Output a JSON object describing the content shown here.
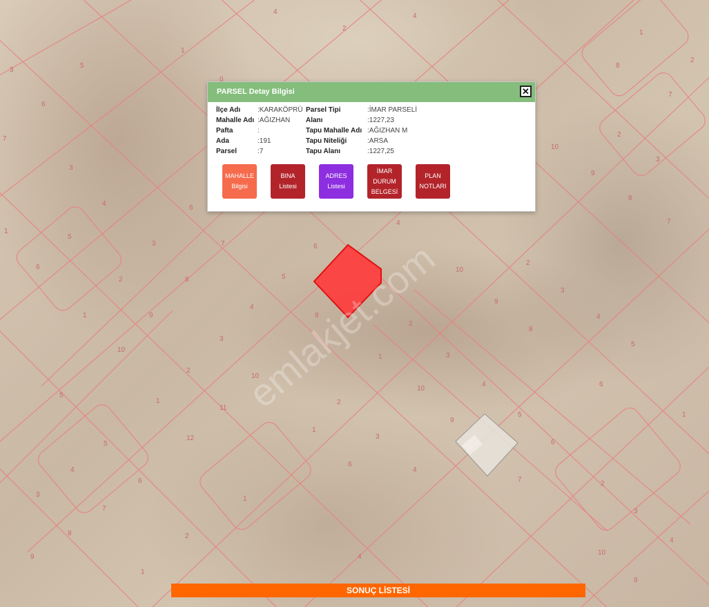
{
  "map": {
    "parcel_numbers": [
      "3",
      "5",
      "6",
      "4",
      "2",
      "1",
      "8",
      "7",
      "10",
      "9",
      "12"
    ],
    "selected_parcel_color": "#ff3b3b",
    "parcel_line_color": "#e8807f"
  },
  "popup": {
    "title": "PARSEL Detay Bilgisi",
    "close_icon": "close-icon",
    "left_fields": [
      {
        "label": "İlçe Adı",
        "value": ":KARAKÖPRÜ"
      },
      {
        "label": "Mahalle Adı",
        "value": ":AĞIZHAN"
      },
      {
        "label": "Pafta",
        "value": ":"
      },
      {
        "label": "Ada",
        "value": ":191"
      },
      {
        "label": "Parsel",
        "value": ":7"
      }
    ],
    "right_fields": [
      {
        "label": "Parsel Tipi",
        "value": ":İMAR PARSELİ"
      },
      {
        "label": "Alanı",
        "value": ":1227,23"
      },
      {
        "label": "Tapu Mahalle Adı",
        "value": ":AĞIZHAN M"
      },
      {
        "label": "Tapu Niteliği",
        "value": ":ARSA"
      },
      {
        "label": "Tapu Alanı",
        "value": ":1227,25"
      }
    ],
    "buttons": [
      {
        "label": "MAHALLE\nBilgisi",
        "color": "#f56b4c"
      },
      {
        "label": "BINA\nListesi",
        "color": "#b2242a"
      },
      {
        "label": "ADRES\nListesi",
        "color": "#8d2ee0"
      },
      {
        "label": "İMAR\nDURUM\nBELGESİ",
        "color": "#b2242a"
      },
      {
        "label": "PLAN\nNOTLARI",
        "color": "#b2242a"
      }
    ]
  },
  "footer": {
    "result_button": "SONUÇ LİSTESİ",
    "color": "#ff6600"
  }
}
